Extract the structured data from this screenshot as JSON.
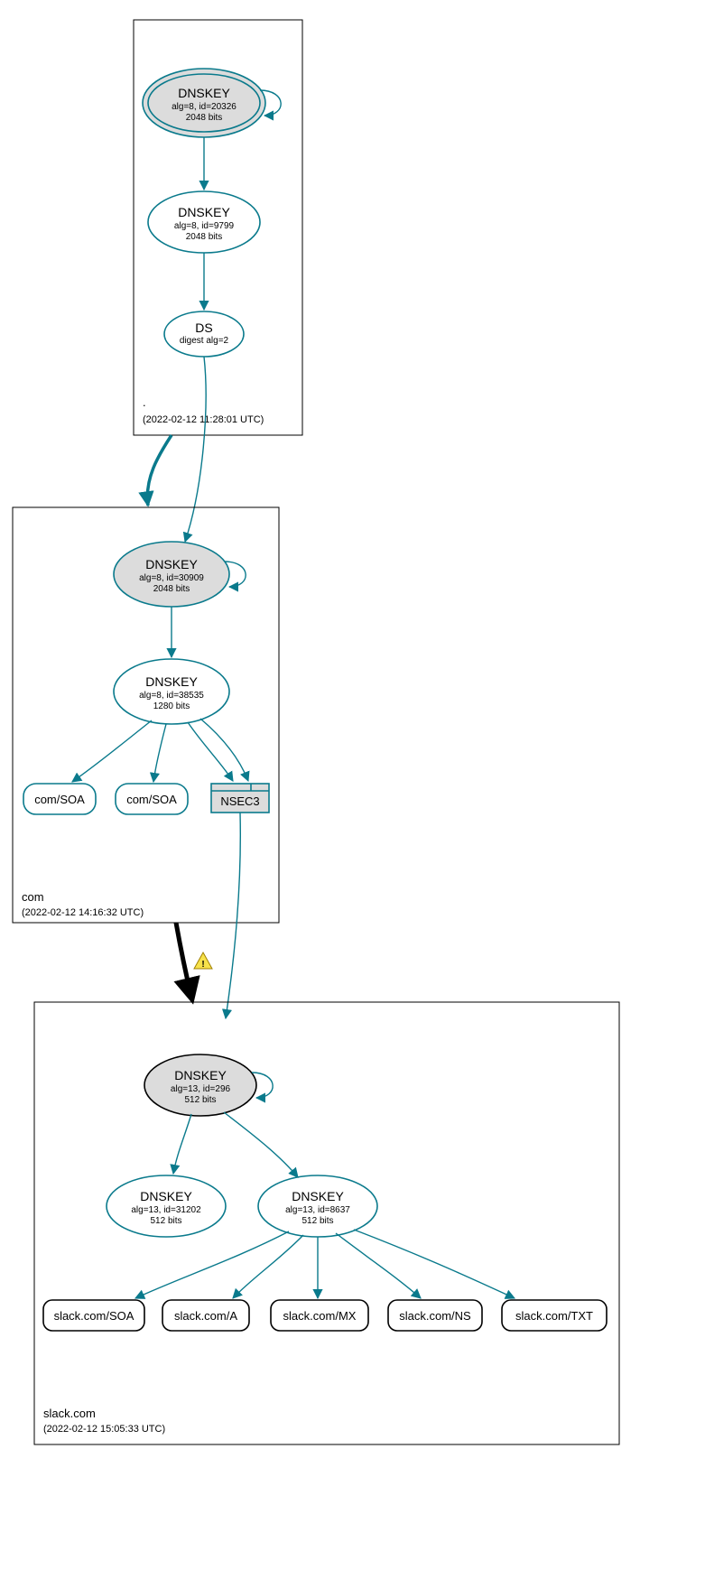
{
  "chart_data": {
    "type": "table",
    "title": "DNSSEC authentication chain for slack.com",
    "zones": [
      {
        "name": ".",
        "analyzed": "2022-02-12 11:28:01 UTC",
        "nodes": [
          {
            "id": "root-ksk",
            "type": "DNSKEY",
            "alg": 8,
            "key_id": 20326,
            "bits": 2048,
            "role": "ksk",
            "fill": "#dcdcdc",
            "double_border": true
          },
          {
            "id": "root-zsk",
            "type": "DNSKEY",
            "alg": 8,
            "key_id": 9799,
            "bits": 2048,
            "role": "zsk"
          },
          {
            "id": "root-ds",
            "type": "DS",
            "digest_alg": 2
          }
        ],
        "edges": [
          {
            "from": "root-ksk",
            "to": "root-ksk"
          },
          {
            "from": "root-ksk",
            "to": "root-zsk"
          },
          {
            "from": "root-zsk",
            "to": "root-ds"
          }
        ]
      },
      {
        "name": "com",
        "analyzed": "2022-02-12 14:16:32 UTC",
        "nodes": [
          {
            "id": "com-ksk",
            "type": "DNSKEY",
            "alg": 8,
            "key_id": 30909,
            "bits": 2048,
            "role": "ksk",
            "fill": "#dcdcdc"
          },
          {
            "id": "com-zsk",
            "type": "DNSKEY",
            "alg": 8,
            "key_id": 38535,
            "bits": 1280,
            "role": "zsk"
          },
          {
            "id": "com-soa1",
            "type": "RRset",
            "label": "com/SOA"
          },
          {
            "id": "com-soa2",
            "type": "RRset",
            "label": "com/SOA"
          },
          {
            "id": "com-nsec3",
            "type": "NSEC3",
            "label": "NSEC3",
            "fill": "#dcdcdc"
          }
        ],
        "edges": [
          {
            "from": "root-ds",
            "to": "com-ksk"
          },
          {
            "from": "com-ksk",
            "to": "com-ksk"
          },
          {
            "from": "com-ksk",
            "to": "com-zsk"
          },
          {
            "from": "com-zsk",
            "to": "com-soa1"
          },
          {
            "from": "com-zsk",
            "to": "com-soa2"
          },
          {
            "from": "com-zsk",
            "to": "com-nsec3"
          }
        ]
      },
      {
        "name": "slack.com",
        "analyzed": "2022-02-12 15:05:33 UTC",
        "nodes": [
          {
            "id": "slack-ksk",
            "type": "DNSKEY",
            "alg": 13,
            "key_id": 296,
            "bits": 512,
            "role": "ksk",
            "fill": "#dcdcdc",
            "border": "#000"
          },
          {
            "id": "slack-zsk1",
            "type": "DNSKEY",
            "alg": 13,
            "key_id": 31202,
            "bits": 512,
            "role": "zsk"
          },
          {
            "id": "slack-zsk2",
            "type": "DNSKEY",
            "alg": 13,
            "key_id": 8637,
            "bits": 512,
            "role": "zsk"
          },
          {
            "id": "slack-soa",
            "type": "RRset",
            "label": "slack.com/SOA"
          },
          {
            "id": "slack-a",
            "type": "RRset",
            "label": "slack.com/A"
          },
          {
            "id": "slack-mx",
            "type": "RRset",
            "label": "slack.com/MX"
          },
          {
            "id": "slack-ns",
            "type": "RRset",
            "label": "slack.com/NS"
          },
          {
            "id": "slack-txt",
            "type": "RRset",
            "label": "slack.com/TXT"
          }
        ],
        "edges": [
          {
            "from": "com-nsec3",
            "to": "slack-ksk",
            "warning": true
          },
          {
            "from": "com",
            "to": "slack.com",
            "style": "delegation-black-thick"
          },
          {
            "from": "slack-ksk",
            "to": "slack-ksk"
          },
          {
            "from": "slack-ksk",
            "to": "slack-zsk1"
          },
          {
            "from": "slack-ksk",
            "to": "slack-zsk2"
          },
          {
            "from": "slack-zsk2",
            "to": "slack-soa"
          },
          {
            "from": "slack-zsk2",
            "to": "slack-a"
          },
          {
            "from": "slack-zsk2",
            "to": "slack-mx"
          },
          {
            "from": "slack-zsk2",
            "to": "slack-ns"
          },
          {
            "from": "slack-zsk2",
            "to": "slack-txt"
          }
        ]
      }
    ],
    "zone_delegations": [
      {
        "from": ".",
        "to": "com",
        "style": "thick-teal"
      },
      {
        "from": "com",
        "to": "slack.com",
        "style": "thick-black",
        "warning": true
      }
    ]
  },
  "labels": {
    "dnskey": "DNSKEY",
    "ds": "DS",
    "nsec3": "NSEC3",
    "alg_prefix": "alg=",
    "id_prefix": "id=",
    "digest_prefix": "digest alg=",
    "bits_suffix": " bits"
  },
  "zones": {
    "root": {
      "name": ".",
      "ts": "(2022-02-12 11:28:01 UTC)"
    },
    "com": {
      "name": "com",
      "ts": "(2022-02-12 14:16:32 UTC)"
    },
    "slack": {
      "name": "slack.com",
      "ts": "(2022-02-12 15:05:33 UTC)"
    }
  },
  "nodes": {
    "root_ksk": {
      "title": "DNSKEY",
      "sub1": "alg=8, id=20326",
      "sub2": "2048 bits"
    },
    "root_zsk": {
      "title": "DNSKEY",
      "sub1": "alg=8, id=9799",
      "sub2": "2048 bits"
    },
    "root_ds": {
      "title": "DS",
      "sub1": "digest alg=2"
    },
    "com_ksk": {
      "title": "DNSKEY",
      "sub1": "alg=8, id=30909",
      "sub2": "2048 bits"
    },
    "com_zsk": {
      "title": "DNSKEY",
      "sub1": "alg=8, id=38535",
      "sub2": "1280 bits"
    },
    "com_soa1": {
      "label": "com/SOA"
    },
    "com_soa2": {
      "label": "com/SOA"
    },
    "com_nsec3": {
      "label": "NSEC3"
    },
    "slack_ksk": {
      "title": "DNSKEY",
      "sub1": "alg=13, id=296",
      "sub2": "512 bits"
    },
    "slack_zsk1": {
      "title": "DNSKEY",
      "sub1": "alg=13, id=31202",
      "sub2": "512 bits"
    },
    "slack_zsk2": {
      "title": "DNSKEY",
      "sub1": "alg=13, id=8637",
      "sub2": "512 bits"
    },
    "slack_soa": {
      "label": "slack.com/SOA"
    },
    "slack_a": {
      "label": "slack.com/A"
    },
    "slack_mx": {
      "label": "slack.com/MX"
    },
    "slack_ns": {
      "label": "slack.com/NS"
    },
    "slack_txt": {
      "label": "slack.com/TXT"
    }
  }
}
